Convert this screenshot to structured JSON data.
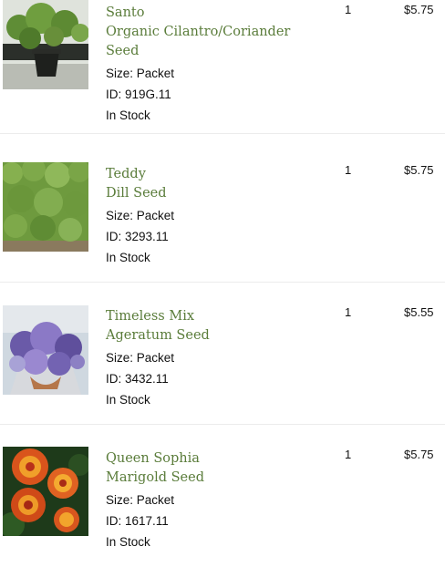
{
  "items": [
    {
      "name_line1": "Santo",
      "name_line2": "Organic Cilantro/Coriander",
      "name_line3": "Seed",
      "size": "Size: Packet",
      "id": "ID: 919G.11",
      "stock": "In Stock",
      "qty": "1",
      "price": "$5.75",
      "image": "cilantro-plants-photo"
    },
    {
      "name_line1": "Teddy",
      "name_line2": "Dill Seed",
      "size": "Size: Packet",
      "id": "ID: 3293.11",
      "stock": "In Stock",
      "qty": "1",
      "price": "$5.75",
      "image": "dill-plants-photo"
    },
    {
      "name_line1": "Timeless Mix",
      "name_line2": "Ageratum Seed",
      "size": "Size: Packet",
      "id": "ID: 3432.11",
      "stock": "In Stock",
      "qty": "1",
      "price": "$5.55",
      "image": "ageratum-bouquet-photo"
    },
    {
      "name_line1": "Queen Sophia",
      "name_line2": "Marigold Seed",
      "size": "Size: Packet",
      "id": "ID: 1617.11",
      "stock": "In Stock",
      "qty": "1",
      "price": "$5.75",
      "image": "marigold-flowers-photo"
    }
  ],
  "colors": {
    "product_name": "#5a7c3a",
    "text": "#111111",
    "divider": "#ececec"
  }
}
